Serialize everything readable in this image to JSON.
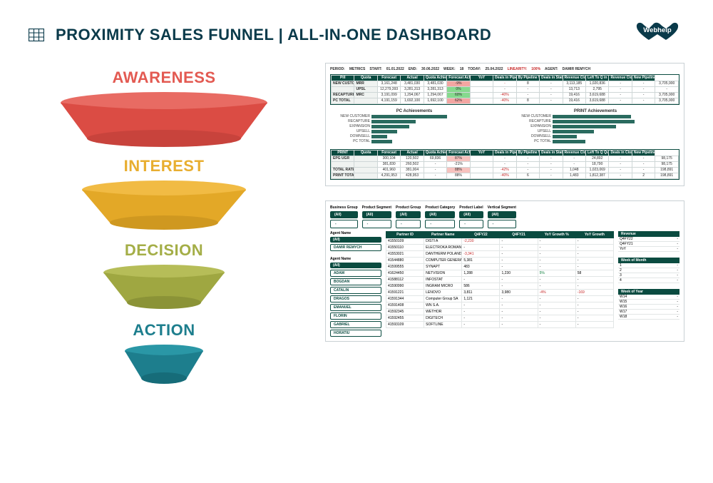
{
  "title": "PROXIMITY SALES FUNNEL | ALL-IN-ONE DASHBOARD",
  "brand": "Webhelp",
  "funnel": {
    "stages": [
      "AWARENESS",
      "INTEREST",
      "DECISION",
      "ACTION"
    ],
    "colors": [
      "#e15a52",
      "#e8ae30",
      "#a4ae47",
      "#1d7e8d"
    ]
  },
  "dash_top": {
    "meta_labels": [
      "PERIOD:",
      "METRICS",
      "START:",
      "01.01.2022",
      "END:",
      "30.06.2022",
      "WEEK:",
      "18",
      "TODAY:",
      "25.04.2022",
      "LINEARITY:",
      "100%",
      "AGENT:",
      "DAMIR REMYCH"
    ],
    "headers": [
      "Pill",
      "Quota",
      "Forecast",
      "Actual",
      "Quota Achievement",
      "Forecast Achievement",
      "YoY",
      "Deals in Pipeline",
      "By Pipeline Won/Lost/DR",
      "Deals in Status/Closed",
      "Revenue Closed",
      "Left To Q in BU",
      "Revenue Closed/Status",
      "New Pipeline"
    ],
    "rows_pc": [
      {
        "label": "NEW CUSTOMER",
        "sub": "MRR",
        "cells": [
          "3,161,248",
          "3,481,030",
          "3,481,030",
          "-9%",
          "",
          "-",
          "8",
          "-",
          "3,113,185",
          "1,020,836",
          "-",
          "-",
          "3,705,900"
        ],
        "flags": [
          "",
          "",
          "",
          "red",
          "",
          "neg",
          "",
          "",
          "",
          "",
          "",
          "",
          ""
        ]
      },
      {
        "label": "",
        "sub": "UPSL",
        "cells": [
          "12,279,393",
          "3,281,313",
          "3,281,313",
          "0%",
          "",
          "-",
          "-",
          "-",
          "13,713",
          "2,795",
          "-",
          "-",
          "-"
        ],
        "flags": [
          "",
          "",
          "",
          "green",
          "",
          "",
          "",
          "",
          "",
          "",
          "",
          "",
          ""
        ]
      },
      {
        "label": "RECAPTURE",
        "sub": "MRC",
        "cells": [
          "3,191,099",
          "1,294,067",
          "1,294,067",
          "60%",
          "",
          "-40%",
          "-",
          "-",
          "19,416",
          "3,619,688",
          "-",
          "-",
          "3,705,900"
        ],
        "flags": [
          "",
          "",
          "",
          "green",
          "",
          "neg",
          "",
          "",
          "",
          "",
          "",
          "",
          ""
        ]
      },
      {
        "label": "PC TOTAL",
        "sub": "",
        "cells": [
          "4,191,159",
          "1,692,100",
          "1,692,100",
          "62%",
          "",
          "-40%",
          "8",
          "-",
          "19,416",
          "3,619,688",
          "-",
          "-",
          "3,705,900"
        ],
        "flags": [
          "",
          "",
          "",
          "red",
          "",
          "neg",
          "",
          "",
          "",
          "",
          "",
          "",
          ""
        ]
      }
    ],
    "chart_data": {
      "type": "bar",
      "orientation": "horizontal",
      "title_left": "PC Achievements",
      "title_right": "PRINT Achievements",
      "categories": [
        "NEW CUSTOMER",
        "RECAPTURE",
        "EXPANSION",
        "UPSELL",
        "DOWNSELL",
        "PC TOTAL"
      ],
      "left_values": [
        88,
        52,
        44,
        30,
        18,
        24
      ],
      "right_values": [
        92,
        96,
        74,
        48,
        28,
        38
      ],
      "unit": "%",
      "max": 100
    },
    "headers2": [
      "PRINT",
      "Quota",
      "Forecast",
      "Actual",
      "Quota Achievement",
      "Forecast Achievement",
      "YoY",
      "Deals in Pipeline",
      "By Pipeline Won/Lost/DR",
      "Deals in Status/Closed",
      "Revenue Closed",
      "Left To Q Quota",
      "Deals in Closed/Status",
      "New Pipeline"
    ],
    "rows_print": [
      {
        "label": "EPG UGR",
        "sub": "",
        "cells": [
          "300,104",
          "120,502",
          "69,836",
          "87%",
          "",
          "-",
          "-",
          "-",
          "-",
          "24,892",
          "-",
          "-",
          "98,175"
        ],
        "flags": [
          "",
          "",
          "",
          "lred",
          "",
          "",
          "",
          "",
          "",
          "",
          "",
          "",
          ""
        ]
      },
      {
        "label": "",
        "sub": "",
        "cells": [
          "381,830",
          "260,502",
          "-",
          "-21%",
          "",
          "-",
          "-",
          "-",
          "-",
          "18,790",
          "-",
          "-",
          "98,175"
        ],
        "flags": [
          "",
          "",
          "",
          "",
          "",
          "",
          "",
          "",
          "",
          "",
          "",
          "",
          ""
        ]
      },
      {
        "label": "TOTAL RATE",
        "sub": "",
        "cells": [
          "401,960",
          "381,004",
          "-",
          "88%",
          "",
          "-42%",
          "-",
          "-",
          "1,048",
          "1,023,069",
          "-",
          "-",
          "198,891"
        ],
        "flags": [
          "",
          "",
          "",
          "lred",
          "",
          "neg",
          "",
          "",
          "",
          "",
          "",
          "",
          ""
        ]
      },
      {
        "label": "PRINT TOTAL",
        "sub": "",
        "cells": [
          "4,291,953",
          "428,953",
          "-",
          "88%",
          "",
          "-40%",
          "6",
          "-",
          "1,483",
          "1,812,387",
          "-",
          "2",
          "198,891"
        ],
        "flags": [
          "",
          "",
          "",
          "",
          "",
          "neg",
          "",
          "",
          "",
          "",
          "",
          "",
          ""
        ]
      }
    ]
  },
  "dash_bottom": {
    "filter_groups": [
      {
        "label": "Business Group",
        "items": [
          "(All)",
          "-"
        ]
      },
      {
        "label": "Product Segment",
        "items": [
          "(All)",
          "-"
        ]
      },
      {
        "label": "Product Group",
        "items": [
          "(All)",
          "-"
        ]
      },
      {
        "label": "Product Category",
        "items": [
          "(All)",
          "-"
        ]
      },
      {
        "label": "Product Label",
        "items": [
          "(All)",
          "-"
        ]
      },
      {
        "label": "Vertical Segment",
        "items": [
          "(All)",
          "-"
        ]
      }
    ],
    "side": [
      {
        "title": "Agent Name",
        "items": [
          "(All)",
          "DAMIR REMYCH"
        ]
      },
      {
        "title": "Agent Name",
        "items": [
          "(All)",
          "ADAM",
          "BOGDAN",
          "CATALIN",
          "DRAGOS",
          "EMANUEL",
          "FLORIN",
          "GABRIEL",
          "HORATIU"
        ]
      }
    ],
    "table_headers": [
      "Partner ID",
      "Partner Name",
      "Q4FY22",
      "Q4FY21",
      "YoY Growth %",
      "YoY Growth"
    ],
    "table_rows": [
      [
        "41550109",
        "DISTI A",
        "-2,230",
        "-",
        "-",
        "-"
      ],
      [
        "41550110",
        "ELECTROKA ROMANIA",
        "-",
        "-",
        "-",
        "-"
      ],
      [
        "41553021",
        "DANTHERM POLAND SOO",
        "-3,341",
        "-",
        "-",
        "-"
      ],
      [
        "41544880",
        "COMPUTER GENERATED SOLUTIONS ROMANIA",
        "5,381",
        "-",
        "-",
        "-"
      ],
      [
        "41599555",
        "SYNAPT",
        "483",
        "-",
        "-",
        "-"
      ],
      [
        "41624450",
        "NETVISION",
        "1,288",
        "1,230",
        "5%",
        "58"
      ],
      [
        "41588112",
        "INFOSTAT",
        "-",
        "-",
        "-",
        "-"
      ],
      [
        "41590990",
        "INGRAM MICRO",
        "586",
        "-",
        "-",
        "-"
      ],
      [
        "41591221",
        "LENOVO",
        "3,811",
        "3,980",
        "-4%",
        "-169"
      ],
      [
        "41591344",
        "Computer Group SA",
        "1,121",
        "-",
        "-",
        "-"
      ],
      [
        "41591408",
        "WN S.A.",
        "-",
        "-",
        "-",
        "-"
      ],
      [
        "41592345",
        "WETHOR",
        "-",
        "-",
        "-",
        "-"
      ],
      [
        "41592455",
        "DIGITECH",
        "-",
        "-",
        "-",
        "-"
      ],
      [
        "41593109",
        "SOFTLINE",
        "-",
        "-",
        "-",
        "-"
      ]
    ],
    "right_cols": [
      {
        "title": "Revenue",
        "rows": [
          [
            "Q4FY22",
            "-"
          ],
          [
            "Q4FY21",
            "-"
          ],
          [
            "YoY",
            "-"
          ]
        ]
      },
      {
        "title": "Week of Month",
        "rows": [
          [
            "1",
            "-"
          ],
          [
            "2",
            "-"
          ],
          [
            "3",
            "-"
          ],
          [
            "4",
            "-"
          ]
        ]
      },
      {
        "title": "Week of Year",
        "rows": [
          [
            "W14",
            "-"
          ],
          [
            "W15",
            "-"
          ],
          [
            "W16",
            "-"
          ],
          [
            "W17",
            "-"
          ],
          [
            "W18",
            "-"
          ]
        ]
      }
    ]
  }
}
